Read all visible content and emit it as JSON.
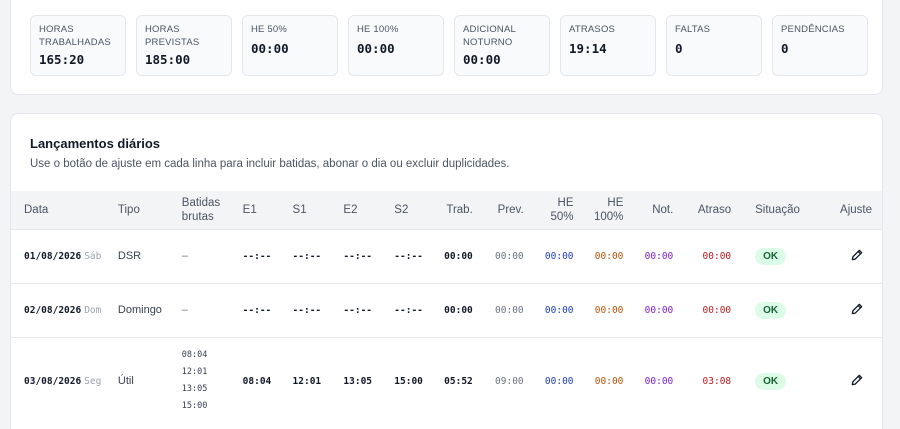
{
  "stats": [
    {
      "label_lines": [
        "HORAS",
        "TRABALHADAS"
      ],
      "value": "165:20"
    },
    {
      "label_lines": [
        "HORAS",
        "PREVISTAS"
      ],
      "value": "185:00"
    },
    {
      "label_lines": [
        "HE 50%"
      ],
      "value": "00:00"
    },
    {
      "label_lines": [
        "HE 100%"
      ],
      "value": "00:00"
    },
    {
      "label_lines": [
        "ADICIONAL",
        "NOTURNO"
      ],
      "value": "00:00"
    },
    {
      "label_lines": [
        "ATRASOS"
      ],
      "value": "19:14"
    },
    {
      "label_lines": [
        "FALTAS"
      ],
      "value": "0"
    },
    {
      "label_lines": [
        "PENDÊNCIAS"
      ],
      "value": "0"
    }
  ],
  "section": {
    "title": "Lançamentos diários",
    "subtitle": "Use o botão de ajuste em cada linha para incluir batidas, abonar o dia ou excluir duplicidades."
  },
  "table": {
    "headers": {
      "data": "Data",
      "tipo": "Tipo",
      "batidas_1": "Batidas",
      "batidas_2": "brutas",
      "e1": "E1",
      "s1": "S1",
      "e2": "E2",
      "s2": "S2",
      "trab": "Trab.",
      "prev": "Prev.",
      "he50_1": "HE",
      "he50_2": "50%",
      "he100_1": "HE",
      "he100_2": "100%",
      "not": "Not.",
      "atraso": "Atraso",
      "situacao": "Situação",
      "ajuste": "Ajuste"
    },
    "rows": [
      {
        "date": "01/08/2026",
        "weekday": "Sáb",
        "tipo": "DSR",
        "batidas": "–",
        "e1": "--:--",
        "s1": "--:--",
        "e2": "--:--",
        "s2": "--:--",
        "trab": "00:00",
        "prev": "00:00",
        "he50": "00:00",
        "he100": "00:00",
        "not": "00:00",
        "atraso": "00:00",
        "situacao": "OK"
      },
      {
        "date": "02/08/2026",
        "weekday": "Dom",
        "tipo": "Domingo",
        "batidas": "–",
        "e1": "--:--",
        "s1": "--:--",
        "e2": "--:--",
        "s2": "--:--",
        "trab": "00:00",
        "prev": "00:00",
        "he50": "00:00",
        "he100": "00:00",
        "not": "00:00",
        "atraso": "00:00",
        "situacao": "OK"
      },
      {
        "date": "03/08/2026",
        "weekday": "Seg",
        "tipo": "Útil",
        "batidas_list": [
          "08:04",
          "12:01",
          "13:05",
          "15:00"
        ],
        "e1": "08:04",
        "s1": "12:01",
        "e2": "13:05",
        "s2": "15:00",
        "trab": "05:52",
        "prev": "09:00",
        "he50": "00:00",
        "he100": "00:00",
        "not": "00:00",
        "atraso": "03:08",
        "situacao": "OK"
      }
    ]
  },
  "icons": {
    "edit": "pencil-icon"
  },
  "colors": {
    "he50": "#1e40af",
    "he100": "#b45309",
    "not": "#7e22ce",
    "atraso": "#b91c1c",
    "ok_bg": "#dcfce7",
    "ok_fg": "#166534"
  }
}
